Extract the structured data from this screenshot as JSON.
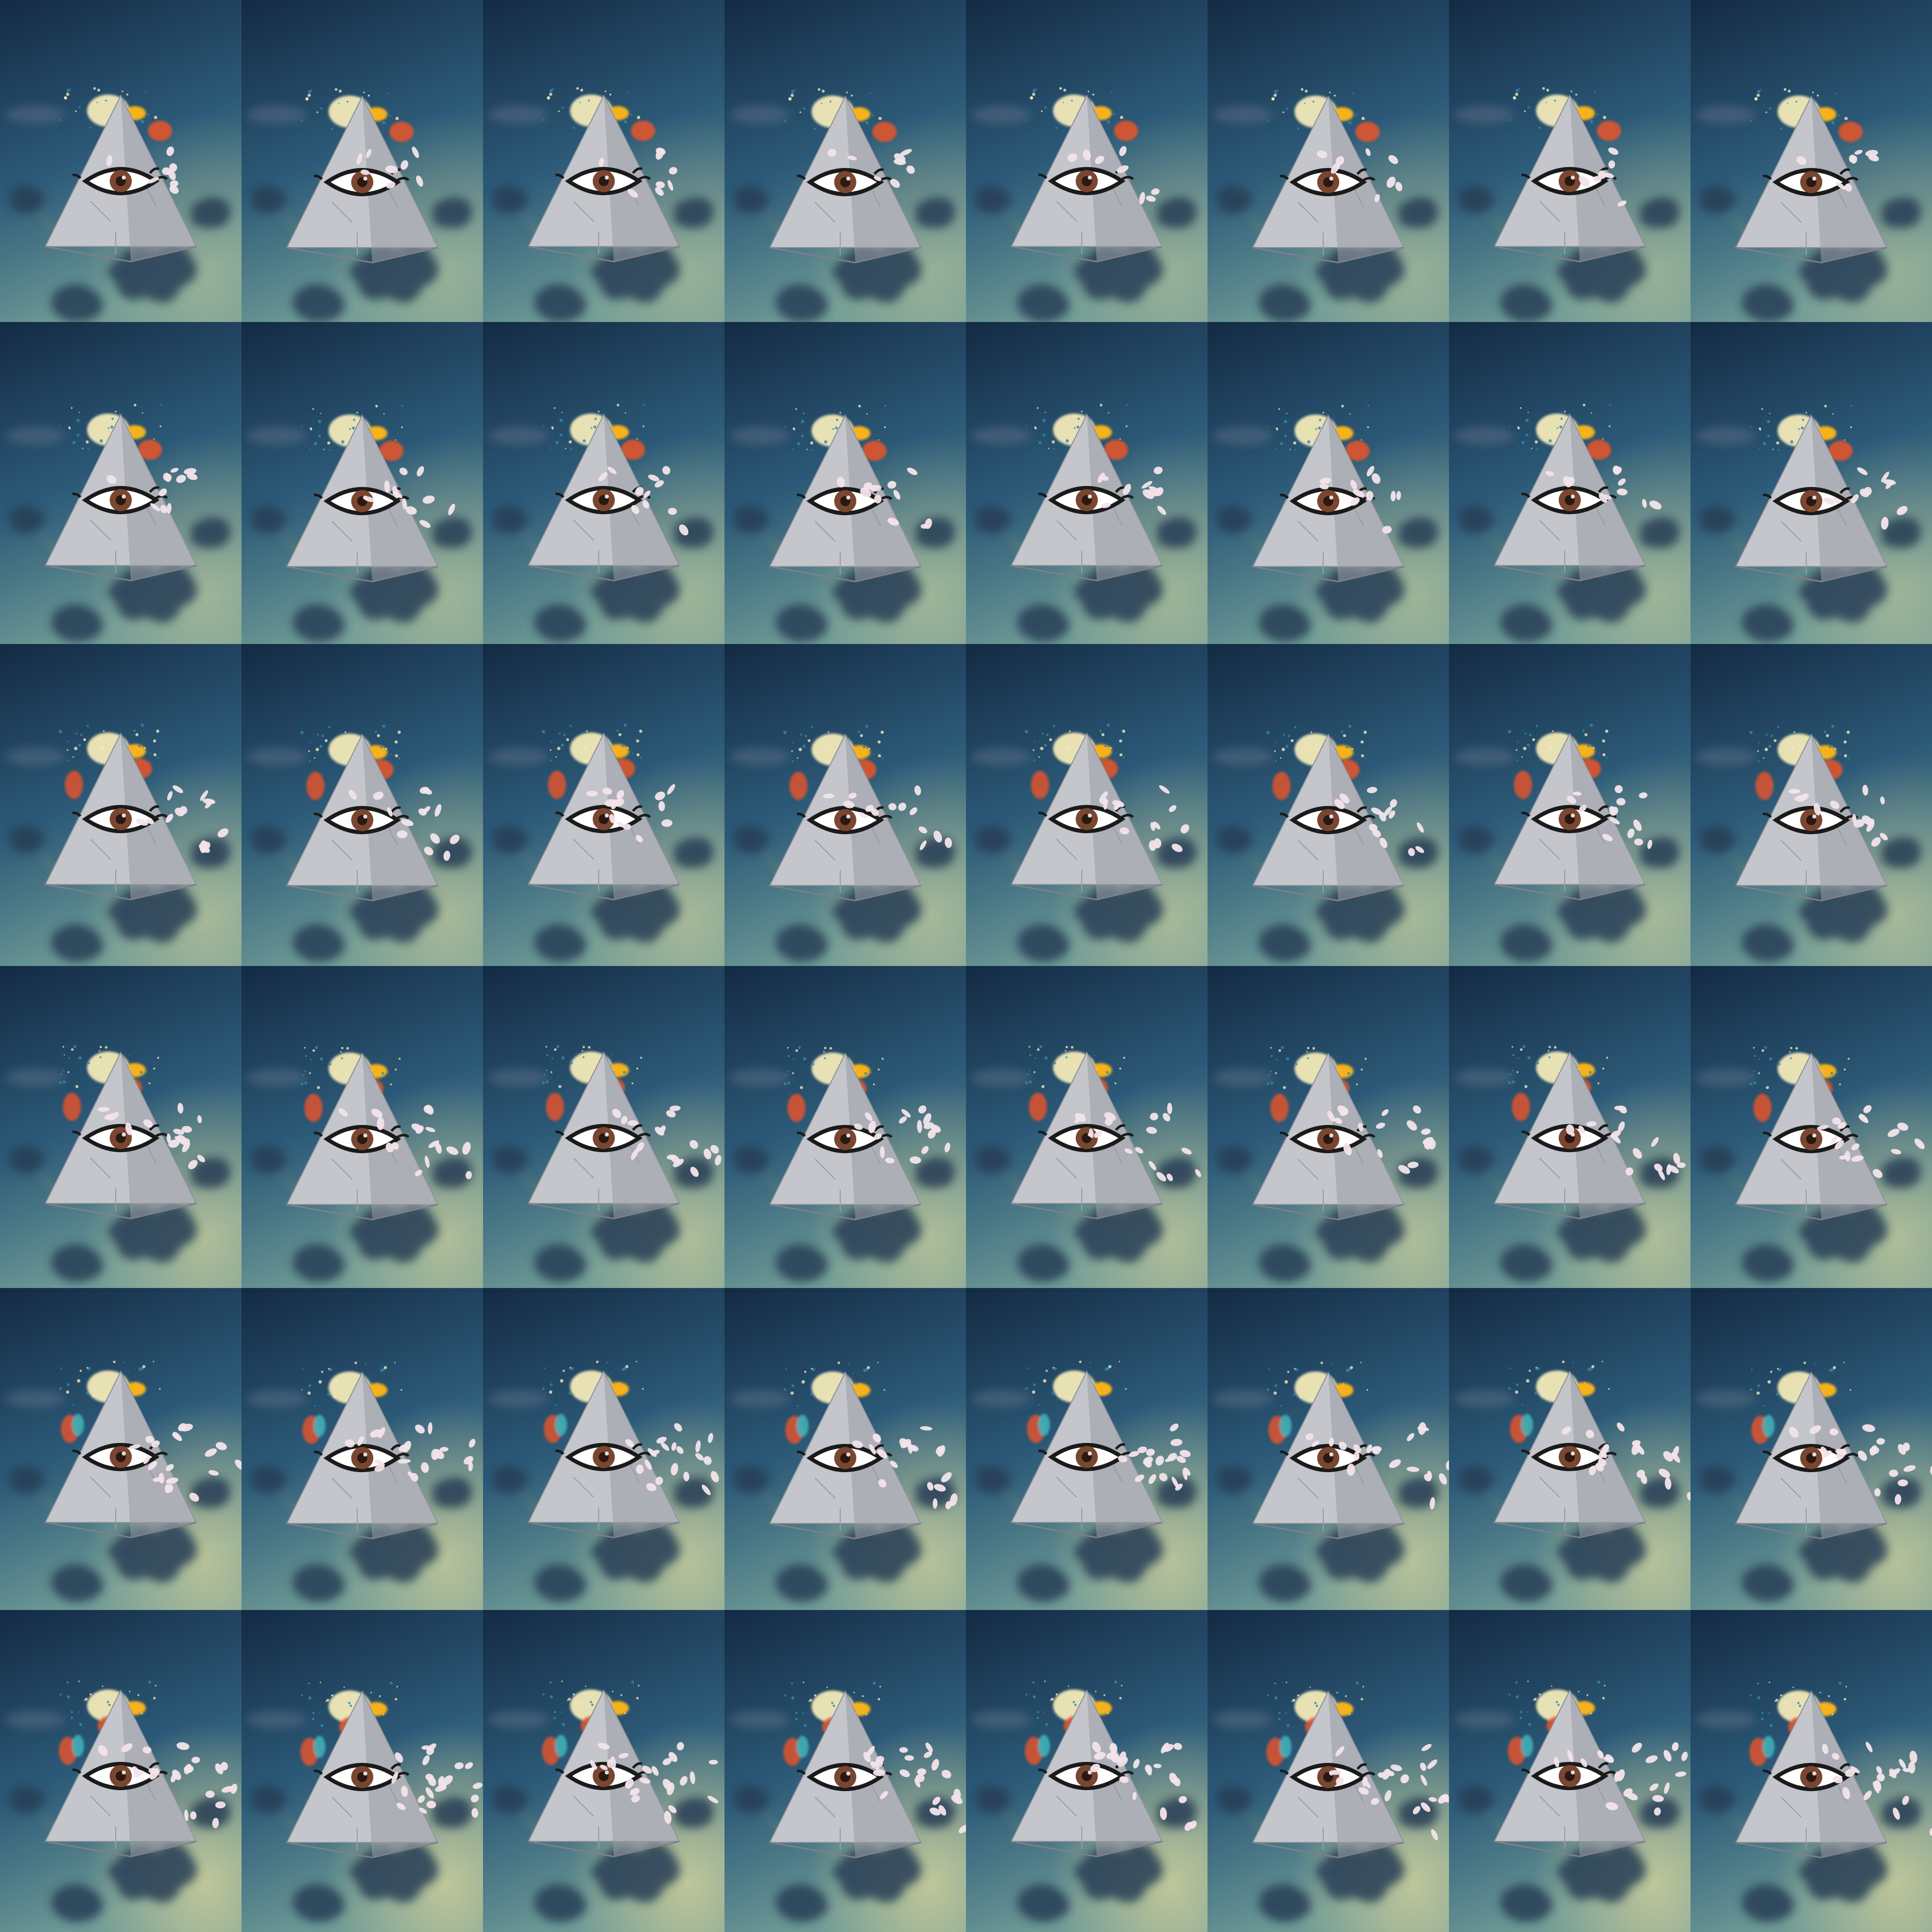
{
  "sheet": {
    "columns": 8,
    "rows": 6,
    "frame_count": 48
  },
  "subject": {
    "description_icon": "eye-pyramid-icon",
    "pyramid_color": "#c4c6cc",
    "pyramid_shadow_color": "#9a9da5",
    "iris_color": "#7a4630",
    "pupil_color": "#2a1812",
    "splash_colors": [
      "#f2e9b8",
      "#f5b21e",
      "#e0542f",
      "#3fb0b8",
      "#2f8aa6"
    ],
    "petal_color": "#f3e4ea"
  },
  "background": {
    "top_color": "#142a44",
    "middle_color": "#2c5a78",
    "bottom_color": "#6e9a96",
    "glow_color": "#d9d49a",
    "cloud_color": "#263e54"
  },
  "animation": {
    "row_phase": [
      0,
      0.2,
      0.4,
      0.6,
      0.8,
      1.0
    ],
    "column_phase": [
      0,
      0.14,
      0.28,
      0.42,
      0.57,
      0.71,
      0.85,
      1.0
    ]
  }
}
